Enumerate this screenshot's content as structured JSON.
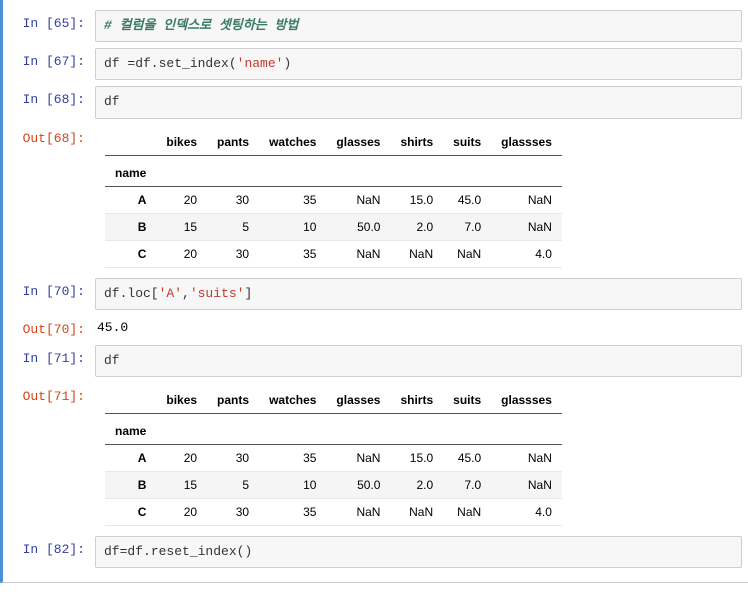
{
  "cells": {
    "c65": {
      "in_label": "In [65]:",
      "comment": "# 컬럼을 인덱스로 셋팅하는 방법"
    },
    "c67": {
      "in_label": "In [67]:",
      "pre": "df =df.",
      "fn": "set_index",
      "paren_open": "(",
      "str": "'name'",
      "paren_close": ")"
    },
    "c68": {
      "in_label": "In [68]:",
      "code": "df",
      "out_label": "Out[68]:"
    },
    "c70": {
      "in_label": "In [70]:",
      "pre": "df.loc[",
      "s1": "'A'",
      "mid": ",",
      "s2": "'suits'",
      "post": "]",
      "out_label": "Out[70]:",
      "out_value": "45.0"
    },
    "c71": {
      "in_label": "In [71]:",
      "code": "df",
      "out_label": "Out[71]:"
    },
    "c82": {
      "in_label": "In [82]:",
      "pre": "df=df.",
      "fn": "reset_index",
      "rest": "()"
    }
  },
  "df": {
    "index_name": "name",
    "columns": [
      "bikes",
      "pants",
      "watches",
      "glasses",
      "shirts",
      "suits",
      "glassses"
    ],
    "rows": [
      {
        "idx": "A",
        "vals": [
          "20",
          "30",
          "35",
          "NaN",
          "15.0",
          "45.0",
          "NaN"
        ]
      },
      {
        "idx": "B",
        "vals": [
          "15",
          "5",
          "10",
          "50.0",
          "2.0",
          "7.0",
          "NaN"
        ]
      },
      {
        "idx": "C",
        "vals": [
          "20",
          "30",
          "35",
          "NaN",
          "NaN",
          "NaN",
          "4.0"
        ]
      }
    ]
  }
}
